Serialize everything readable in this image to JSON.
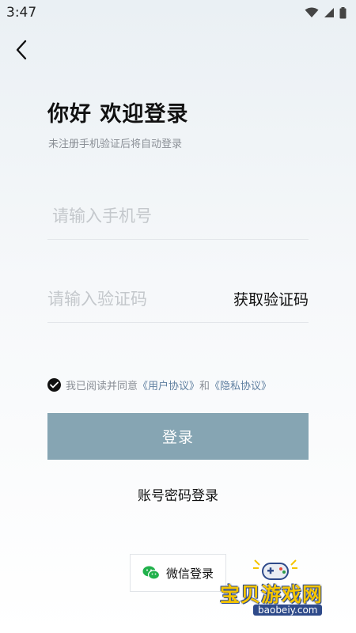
{
  "status_bar": {
    "time": "3:47",
    "icons": [
      "wifi-icon",
      "signal-icon",
      "battery-icon"
    ]
  },
  "header": {
    "back_icon": "chevron-left-icon"
  },
  "title": "你好 欢迎登录",
  "subtitle": "未注册手机验证后将自动登录",
  "phone_input": {
    "value": "",
    "placeholder": "请输入手机号"
  },
  "code_input": {
    "value": "",
    "placeholder": "请输入验证码",
    "get_code_label": "获取验证码"
  },
  "agreement": {
    "checked": true,
    "prefix": "我已阅读并同意",
    "user_agreement": "《用户协议》",
    "conjunction": "和",
    "privacy_policy": "《隐私协议》"
  },
  "login_button": {
    "label": "登录",
    "color": "#86a5b3"
  },
  "password_login_label": "账号密码登录",
  "wechat_login": {
    "label": "微信登录",
    "icon": "wechat-icon",
    "color": "#22b14c"
  },
  "watermark": {
    "text": "宝贝游戏网",
    "url": "baobeiy.com"
  }
}
